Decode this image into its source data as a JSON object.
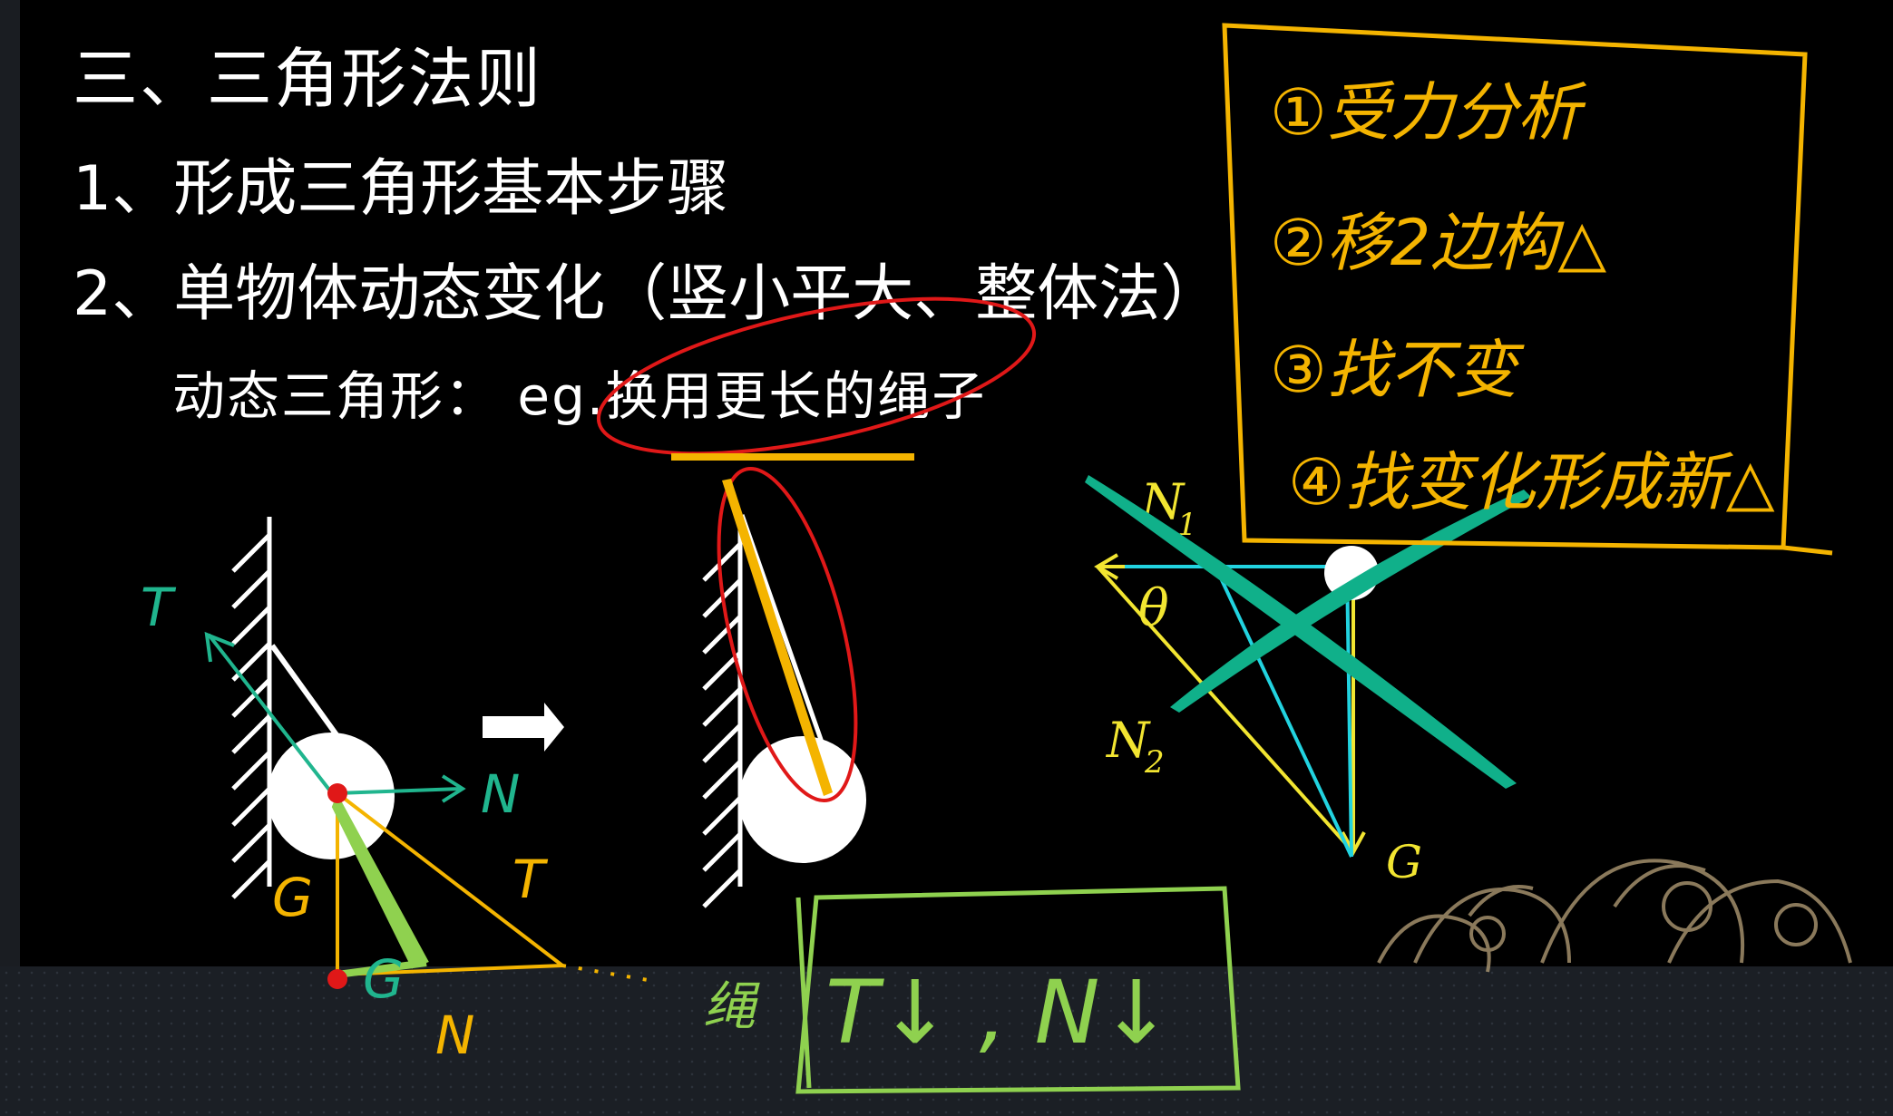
{
  "slide": {
    "title": "三、三角形法则",
    "items": [
      "1、形成三角形基本步骤",
      "2、单物体动态变化（竖小平大、整体法）"
    ],
    "subtext": "动态三角形：  eg.换用更长的绳子"
  },
  "figure": {
    "label_N1": "N",
    "label_N1_sub": "1",
    "label_N2": "N",
    "label_N2_sub": "2",
    "label_theta": "θ",
    "label_G": "G"
  },
  "annotations": {
    "steps": [
      "①受力分析",
      "②移2边构△",
      "③找不变",
      "④找变化形成新△"
    ],
    "left_labels": {
      "T": "T",
      "N": "N",
      "G": "G",
      "G2": "G",
      "T_yellow": "T",
      "N_yellow": "N"
    },
    "result_prefix": "绳",
    "result": "T↓ , N↓"
  },
  "colors": {
    "background": "#000000",
    "text": "#ffffff",
    "yellow_ink": "#f4b400",
    "green_ink": "#20b58e",
    "lime_ink": "#8fd14f",
    "red_ink": "#e01818",
    "cyan_line": "#22d3e0",
    "yellow_line": "#f2e531"
  }
}
